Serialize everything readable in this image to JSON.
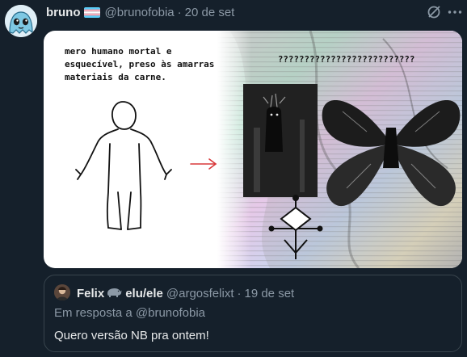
{
  "tweet": {
    "author_name": "bruno",
    "author_handle": "@brunofobia",
    "separator": "·",
    "date": "20 de set",
    "avatar_icon": "blue-blob-avatar-icon",
    "flag_icon": "trans-flag-icon",
    "grok_icon": "grok-icon",
    "more_icon": "more-horizontal-icon"
  },
  "media": {
    "caption": "mero humano mortal e esquecível, preso às amarras materiais da carne.",
    "question": "??????????????????????????",
    "arrow_icon": "red-arrow-icon"
  },
  "quote": {
    "author_name": "Felix",
    "author_emoji": "rhino-icon",
    "author_pronouns": "elu/ele",
    "author_handle": "@argosfelixt",
    "separator": "·",
    "date": "19 de set",
    "reply_to": "Em resposta a @brunofobia",
    "text": "Quero versão NB pra ontem!"
  },
  "colors": {
    "background": "#15202b",
    "text_primary": "#e7e9ea",
    "text_secondary": "#8b98a5",
    "border": "#38444d"
  }
}
